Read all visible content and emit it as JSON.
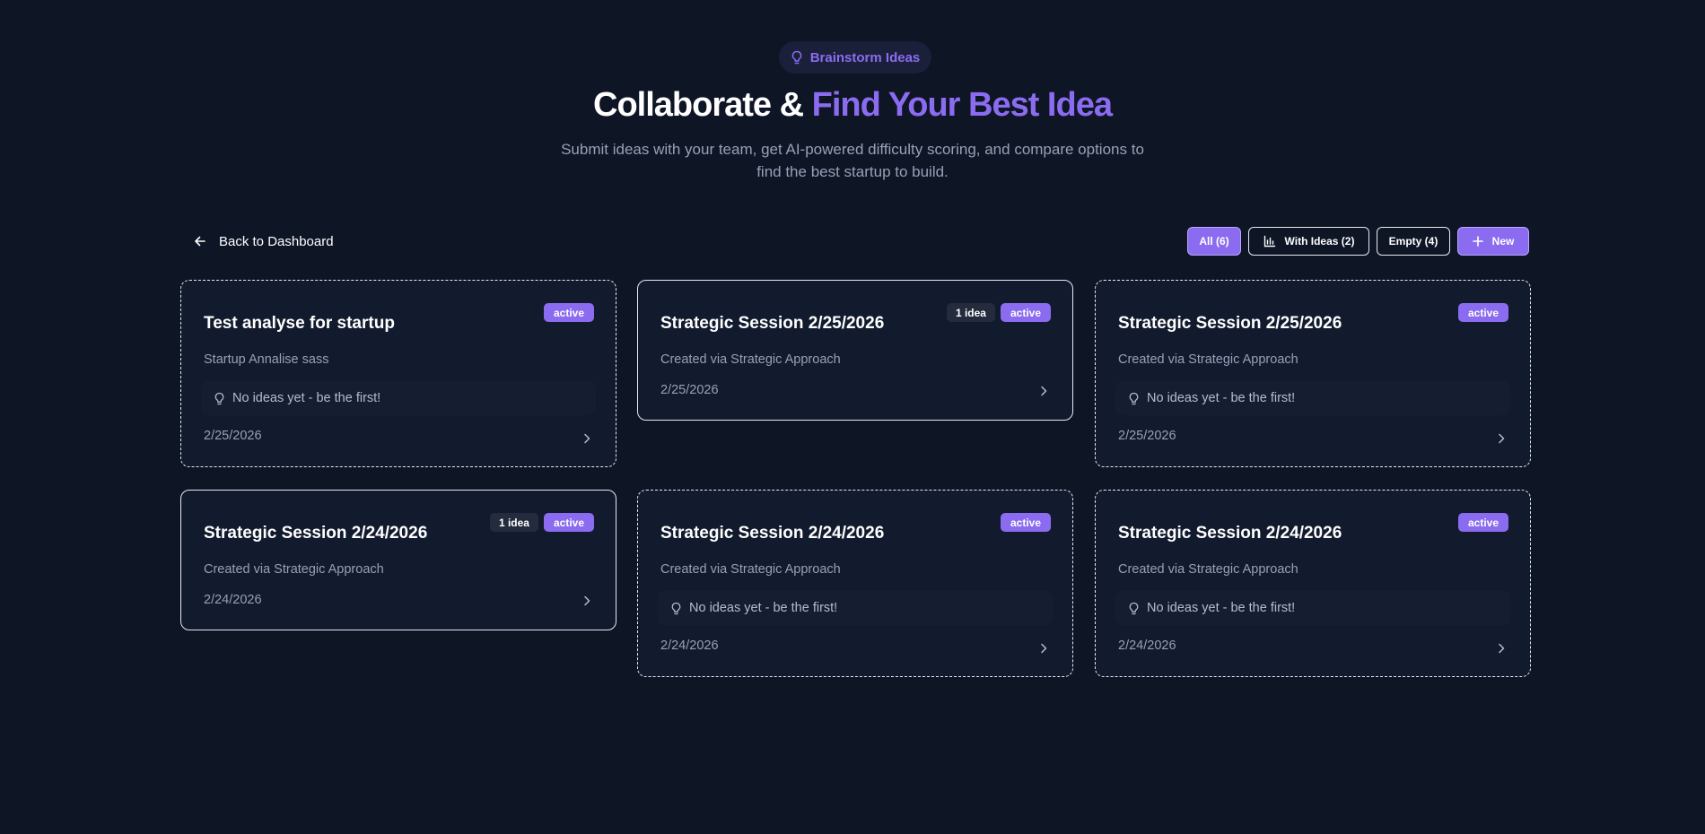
{
  "header": {
    "pill_label": "Brainstorm Ideas",
    "title_main": "Collaborate & ",
    "title_accent": "Find Your Best Idea",
    "subtitle_line1": "Submit ideas with your team, get AI-powered difficulty scoring, and compare options to",
    "subtitle_line2": "find the best startup to build."
  },
  "nav": {
    "back_label": "Back to Dashboard"
  },
  "filters": {
    "all": "All (6)",
    "with_ideas": "With Ideas (2)",
    "empty": "Empty (4)",
    "new": "New"
  },
  "colors": {
    "background": "#0e1525",
    "card": "#121a2e",
    "accent": "#8b6cf0",
    "muted_text": "#97a0b6"
  },
  "cards": [
    {
      "title": "Test analyse for startup",
      "status": "active",
      "ideas_badge": "",
      "description": "Startup Annalise sass",
      "empty_text": "No ideas yet - be the first!",
      "date": "2/25/2026"
    },
    {
      "title": "Strategic Session 2/25/2026",
      "status": "active",
      "ideas_badge": "1 idea",
      "description": "Created via Strategic Approach",
      "empty_text": "",
      "date": "2/25/2026"
    },
    {
      "title": "Strategic Session 2/25/2026",
      "status": "active",
      "ideas_badge": "",
      "description": "Created via Strategic Approach",
      "empty_text": "No ideas yet - be the first!",
      "date": "2/25/2026"
    },
    {
      "title": "Strategic Session 2/24/2026",
      "status": "active",
      "ideas_badge": "1 idea",
      "description": "Created via Strategic Approach",
      "empty_text": "",
      "date": "2/24/2026"
    },
    {
      "title": "Strategic Session 2/24/2026",
      "status": "active",
      "ideas_badge": "",
      "description": "Created via Strategic Approach",
      "empty_text": "No ideas yet - be the first!",
      "date": "2/24/2026"
    },
    {
      "title": "Strategic Session 2/24/2026",
      "status": "active",
      "ideas_badge": "",
      "description": "Created via Strategic Approach",
      "empty_text": "No ideas yet - be the first!",
      "date": "2/24/2026"
    }
  ]
}
